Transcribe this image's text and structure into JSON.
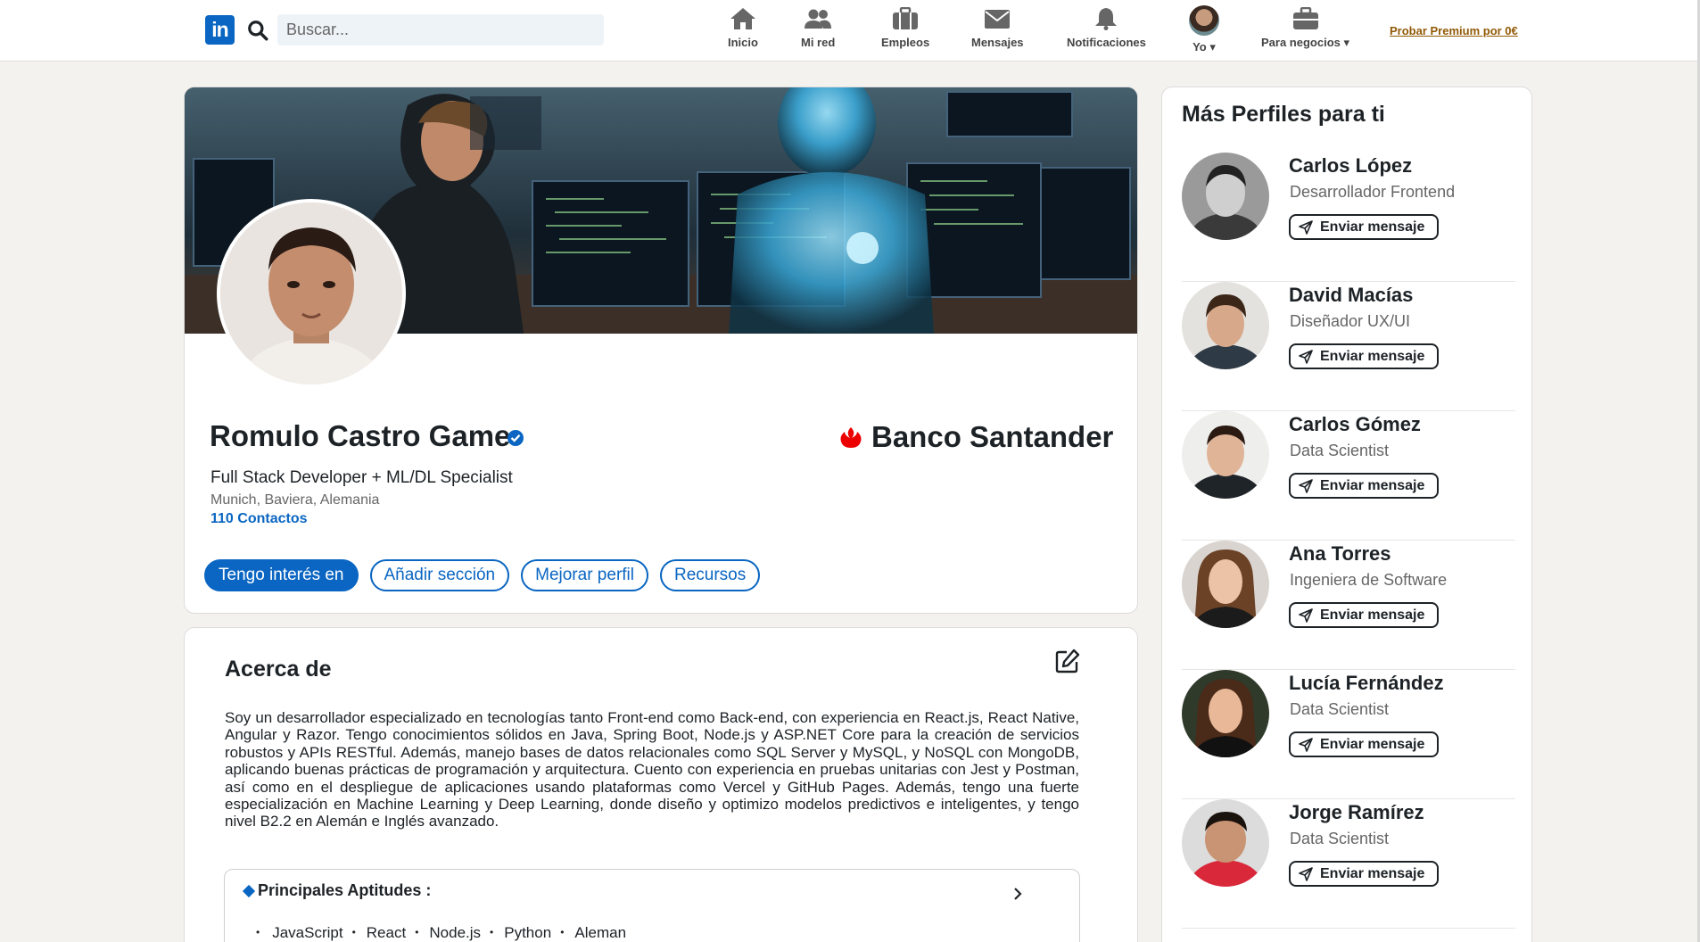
{
  "nav": {
    "logo_text": "in",
    "search_placeholder": "Buscar...",
    "items": [
      {
        "label": "Inicio",
        "icon": "home-icon"
      },
      {
        "label": "Mi red",
        "icon": "network-icon"
      },
      {
        "label": "Empleos",
        "icon": "briefcase-icon"
      },
      {
        "label": "Mensajes",
        "icon": "messages-icon"
      },
      {
        "label": "Notificaciones",
        "icon": "bell-icon"
      }
    ],
    "me_label": "Yo",
    "business_label": "Para negocios",
    "premium_link": "Probar Premium por 0€",
    "accent_color": "#0a66c2",
    "premium_color": "#915907"
  },
  "profile": {
    "name": "Romulo Castro Game",
    "headline": "Full Stack Developer + ML/DL Specialist",
    "location": "Munich, Baviera, Alemania",
    "contacts": "110 Contactos",
    "company": "Banco Santander",
    "company_color": "#ec0000",
    "buttons": [
      "Tengo interés en",
      "Añadir sección",
      "Mejorar perfil",
      "Recursos"
    ]
  },
  "about": {
    "title": "Acerca de",
    "text": "Soy un desarrollador especializado en tecnologías tanto Front-end como Back-end, con experiencia en React.js, React Native, Angular y Razor. Tengo conocimientos sólidos en Java, Spring Boot, Node.js y ASP.NET Core para la creación de servicios robustos y APIs RESTful. Además, manejo bases de datos relacionales como SQL Server y MySQL, y NoSQL con MongoDB, aplicando buenas prácticas de programación y arquitectura. Cuento con experiencia en pruebas unitarias con Jest y Postman, así como en el despliegue de aplicaciones usando plataformas como Vercel y GitHub Pages. Además, tengo una fuerte especialización en Machine Learning y Deep Learning, donde diseño y optimizo modelos predictivos e inteligentes, y tengo nivel B2.2 en Alemán e Inglés avanzado.",
    "skills_title": "Principales Aptitudes :",
    "skills": [
      "JavaScript",
      "React",
      "Node.js",
      "Python",
      "Aleman"
    ]
  },
  "sidebar": {
    "title": "Más Perfiles para ti",
    "message_label": "Enviar mensaje",
    "people": [
      {
        "name": "Carlos López",
        "role": "Desarrollador Frontend"
      },
      {
        "name": "David Macías",
        "role": "Diseñador UX/UI"
      },
      {
        "name": "Carlos Gómez",
        "role": "Data Scientist"
      },
      {
        "name": "Ana Torres",
        "role": "Ingeniera de Software"
      },
      {
        "name": "Lucía Fernández",
        "role": "Data Scientist"
      },
      {
        "name": "Jorge Ramírez",
        "role": "Data Scientist"
      }
    ]
  }
}
